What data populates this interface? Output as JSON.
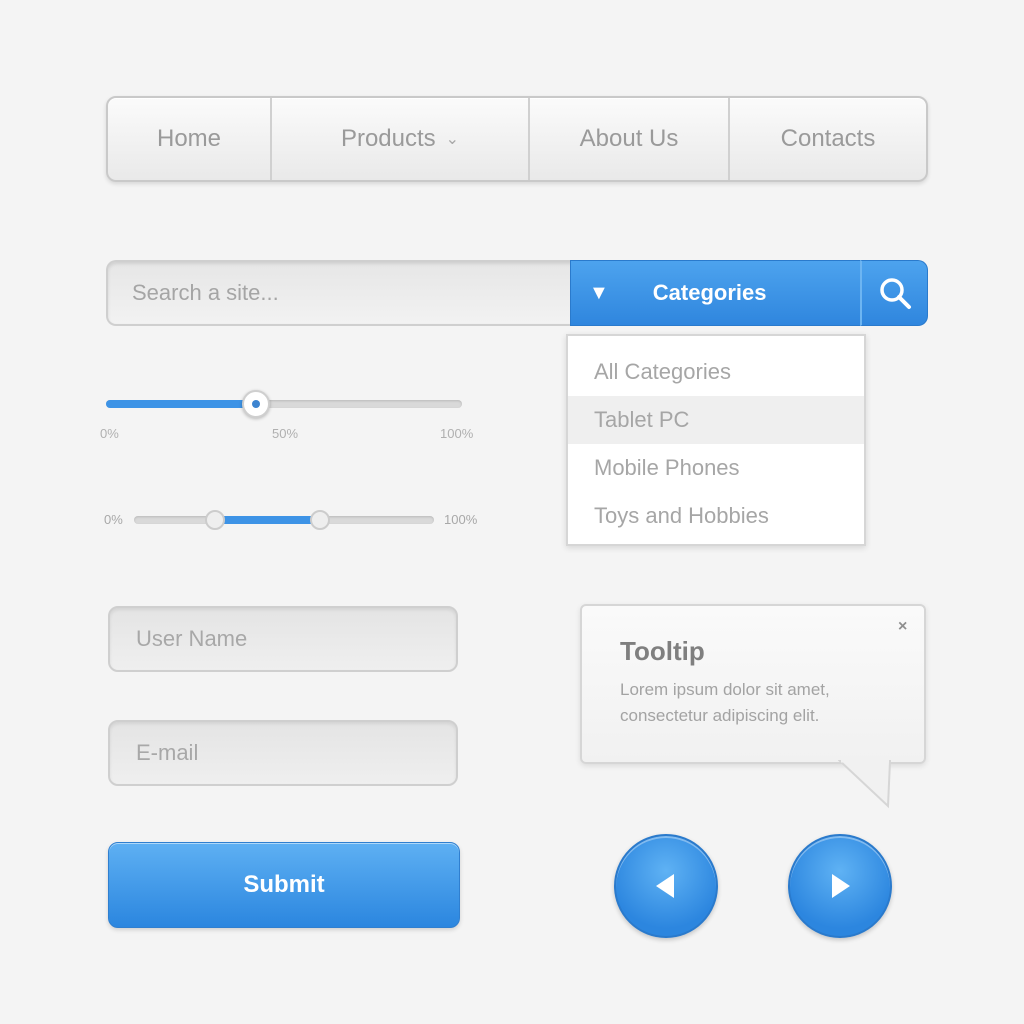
{
  "nav": {
    "items": [
      {
        "label": "Home"
      },
      {
        "label": "Products"
      },
      {
        "label": "About Us"
      },
      {
        "label": "Contacts"
      }
    ]
  },
  "search": {
    "placeholder": "Search a site...",
    "category_label": "Categories"
  },
  "dropdown": {
    "items": [
      {
        "label": "All Categories"
      },
      {
        "label": "Tablet PC"
      },
      {
        "label": "Mobile Phones"
      },
      {
        "label": "Toys and Hobbies"
      }
    ],
    "selected_index": 1
  },
  "slider": {
    "value": 0.42,
    "min_label": "0%",
    "mid_label": "50%",
    "max_label": "100%"
  },
  "range_slider": {
    "low": 0.27,
    "high": 0.62,
    "min_label": "0%",
    "max_label": "100%"
  },
  "form": {
    "username_placeholder": "User Name",
    "email_placeholder": "E-mail",
    "submit_label": "Submit"
  },
  "tooltip": {
    "title": "Tooltip",
    "body": "Lorem ipsum dolor sit amet, consectetur adipiscing elit.",
    "close_symbol": "×"
  },
  "icons": {
    "dropdown": "triangle-down-icon",
    "search": "magnifier-icon",
    "prev": "play-left-icon",
    "next": "play-right-icon"
  },
  "colors": {
    "accent": "#2f86de",
    "accent_light": "#5eb0f3",
    "background": "#f4f4f4"
  }
}
